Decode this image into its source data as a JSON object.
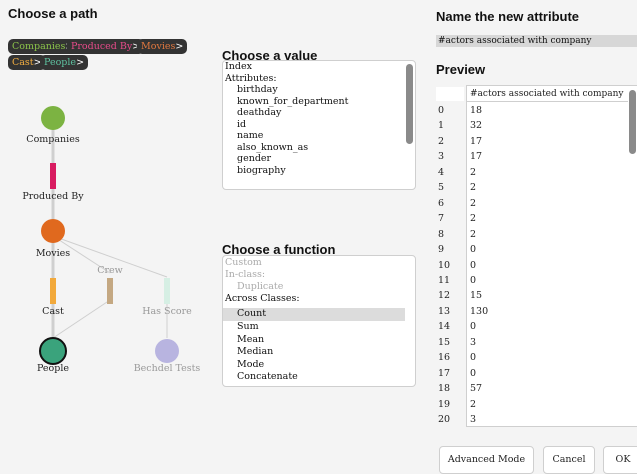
{
  "left": {
    "heading": "Choose a path",
    "path": [
      {
        "label": "Companies",
        "color": "#8bc34a"
      },
      {
        "label": "Produced By",
        "color": "#e84b8a"
      },
      {
        "label": "Movies",
        "color": "#e2783f"
      },
      {
        "label": "Cast",
        "color": "#f5b041"
      },
      {
        "label": "People",
        "color": "#5ec2a0"
      }
    ],
    "arrow": ">",
    "graph": {
      "companies": "Companies",
      "produced_by": "Produced By",
      "movies": "Movies",
      "crew": "Crew",
      "cast": "Cast",
      "has_score": "Has Score",
      "people": "People",
      "bechdel": "Bechdel Tests"
    }
  },
  "value": {
    "heading": "Choose a value",
    "items": [
      "Index",
      "Attributes:",
      "birthday",
      "known_for_department",
      "deathday",
      "id",
      "name",
      "also_known_as",
      "gender",
      "biography"
    ]
  },
  "function": {
    "heading": "Choose a function",
    "items": [
      "Custom",
      "In-class:",
      "Duplicate",
      "Across Classes:",
      "Count",
      "Sum",
      "Mean",
      "Median",
      "Mode",
      "Concatenate"
    ],
    "selected": "Count"
  },
  "attribute": {
    "heading": "Name the new attribute",
    "value": "#actors associated with company"
  },
  "preview": {
    "heading": "Preview",
    "column": "#actors associated with company",
    "rows": [
      [
        "0",
        "18"
      ],
      [
        "1",
        "32"
      ],
      [
        "2",
        "17"
      ],
      [
        "3",
        "17"
      ],
      [
        "4",
        "2"
      ],
      [
        "5",
        "2"
      ],
      [
        "6",
        "2"
      ],
      [
        "7",
        "2"
      ],
      [
        "8",
        "2"
      ],
      [
        "9",
        "0"
      ],
      [
        "10",
        "0"
      ],
      [
        "11",
        "0"
      ],
      [
        "12",
        "15"
      ],
      [
        "13",
        "130"
      ],
      [
        "14",
        "0"
      ],
      [
        "15",
        "3"
      ],
      [
        "16",
        "0"
      ],
      [
        "17",
        "0"
      ],
      [
        "18",
        "57"
      ],
      [
        "19",
        "2"
      ],
      [
        "20",
        "3"
      ]
    ]
  },
  "buttons": {
    "advanced": "Advanced Mode",
    "cancel": "Cancel",
    "ok": "OK"
  }
}
